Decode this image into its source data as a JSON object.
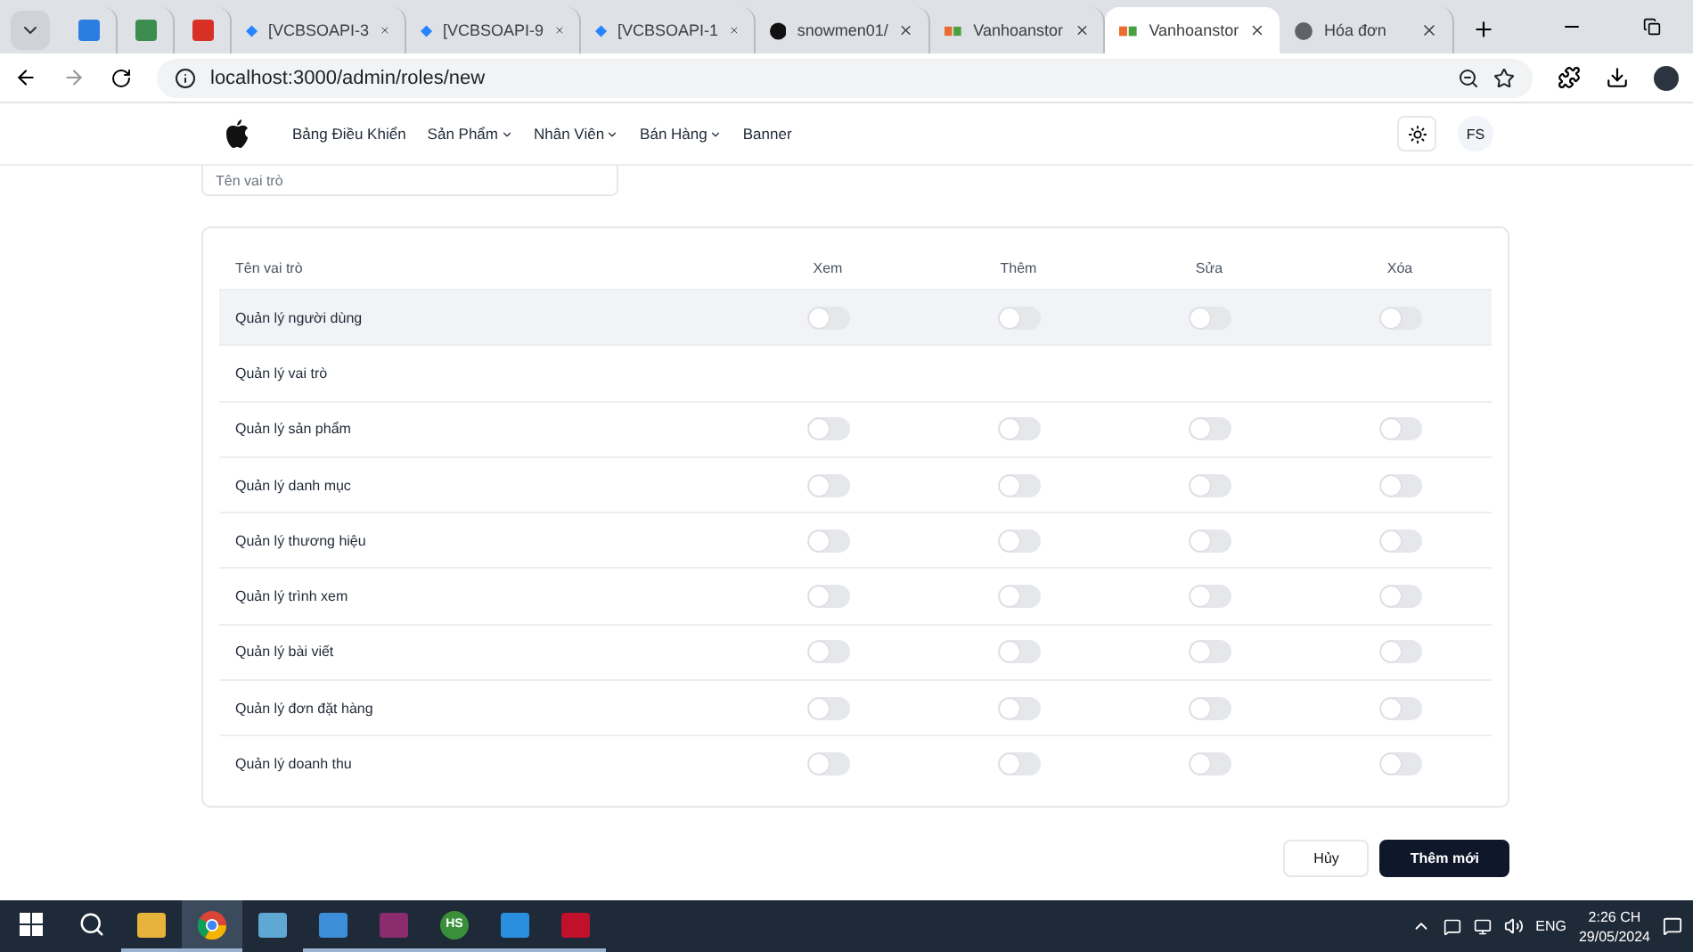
{
  "browser": {
    "tabs": [
      {
        "kind": "pinned",
        "selected": false
      },
      {
        "kind": "pinned",
        "selected": false
      },
      {
        "kind": "pinned",
        "selected": false
      },
      {
        "kind": "tab",
        "title": "[VCBSOAPI-3",
        "selected": false
      },
      {
        "kind": "tab",
        "title": "[VCBSOAPI-9",
        "selected": false
      },
      {
        "kind": "tab",
        "title": "[VCBSOAPI-1",
        "selected": false
      },
      {
        "kind": "tab",
        "title": "snowmen01/",
        "selected": false
      },
      {
        "kind": "tab",
        "title": "Vanhoanstor",
        "selected": false
      },
      {
        "kind": "tab",
        "title": "Vanhoanstor",
        "selected": true
      },
      {
        "kind": "tab",
        "title": "Hóa đơn",
        "selected": false
      }
    ],
    "url": "localhost:3000/admin/roles/new"
  },
  "nav": {
    "items": [
      {
        "label": "Bảng Điều Khiển",
        "dropdown": false
      },
      {
        "label": "Sản Phẩm",
        "dropdown": true
      },
      {
        "label": "Nhân Viên",
        "dropdown": true
      },
      {
        "label": "Bán Hàng",
        "dropdown": true
      },
      {
        "label": "Banner",
        "dropdown": false
      }
    ],
    "avatar": "FS"
  },
  "role_name_field": {
    "placeholder": "Tên vai trò"
  },
  "permissions": {
    "columns": [
      "Tên vai trò",
      "Xem",
      "Thêm",
      "Sửa",
      "Xóa"
    ],
    "rows": [
      {
        "name": "Quản lý người dùng",
        "hovered": true,
        "toggles": [
          {
            "on": false
          },
          {
            "on": false
          },
          {
            "on": false
          },
          {
            "on": false
          }
        ]
      },
      {
        "name": "Quản lý vai trò",
        "hovered": false
      },
      {
        "name": "Quản lý sản phẩm",
        "hovered": false,
        "toggles": [
          {
            "on": false
          },
          {
            "on": false
          },
          {
            "on": false
          },
          {
            "on": false
          }
        ]
      },
      {
        "name": "Quản lý danh mục",
        "hovered": false,
        "toggles": [
          {
            "on": false
          },
          {
            "on": false
          },
          {
            "on": false
          },
          {
            "on": false
          }
        ]
      },
      {
        "name": "Quản lý thương hiệu",
        "hovered": false,
        "toggles": [
          {
            "on": false
          },
          {
            "on": false
          },
          {
            "on": false
          },
          {
            "on": false
          }
        ]
      },
      {
        "name": "Quản lý trình xem",
        "hovered": false,
        "toggles": [
          {
            "on": false
          },
          {
            "on": false
          },
          {
            "on": false
          },
          {
            "on": false
          }
        ]
      },
      {
        "name": "Quản lý bài viết",
        "hovered": false,
        "toggles": [
          {
            "on": false
          },
          {
            "on": false
          },
          {
            "on": false
          },
          {
            "on": false
          }
        ]
      },
      {
        "name": "Quản lý đơn đặt hàng",
        "hovered": false,
        "toggles": [
          {
            "on": false
          },
          {
            "on": false
          },
          {
            "on": false
          },
          {
            "on": false
          }
        ]
      },
      {
        "name": "Quản lý doanh thu",
        "hovered": false,
        "toggles": [
          {
            "on": false
          },
          {
            "on": false
          },
          {
            "on": false
          },
          {
            "on": false
          }
        ]
      }
    ]
  },
  "buttons": [
    {
      "label": "Hủy",
      "kind": "secondary"
    },
    {
      "label": "Thêm mới",
      "kind": "primary"
    }
  ],
  "taskbar": {
    "apps": [
      {
        "active": false,
        "open": true
      },
      {
        "active": true,
        "open": true
      },
      {
        "active": false,
        "open": false
      },
      {
        "active": false,
        "open": true
      },
      {
        "active": false,
        "open": true
      },
      {
        "label": "HS",
        "active": false,
        "open": true
      },
      {
        "active": false,
        "open": true
      },
      {
        "active": false,
        "open": true
      }
    ],
    "language": "ENG",
    "time": "2:26 CH",
    "date": "29/05/2024"
  }
}
